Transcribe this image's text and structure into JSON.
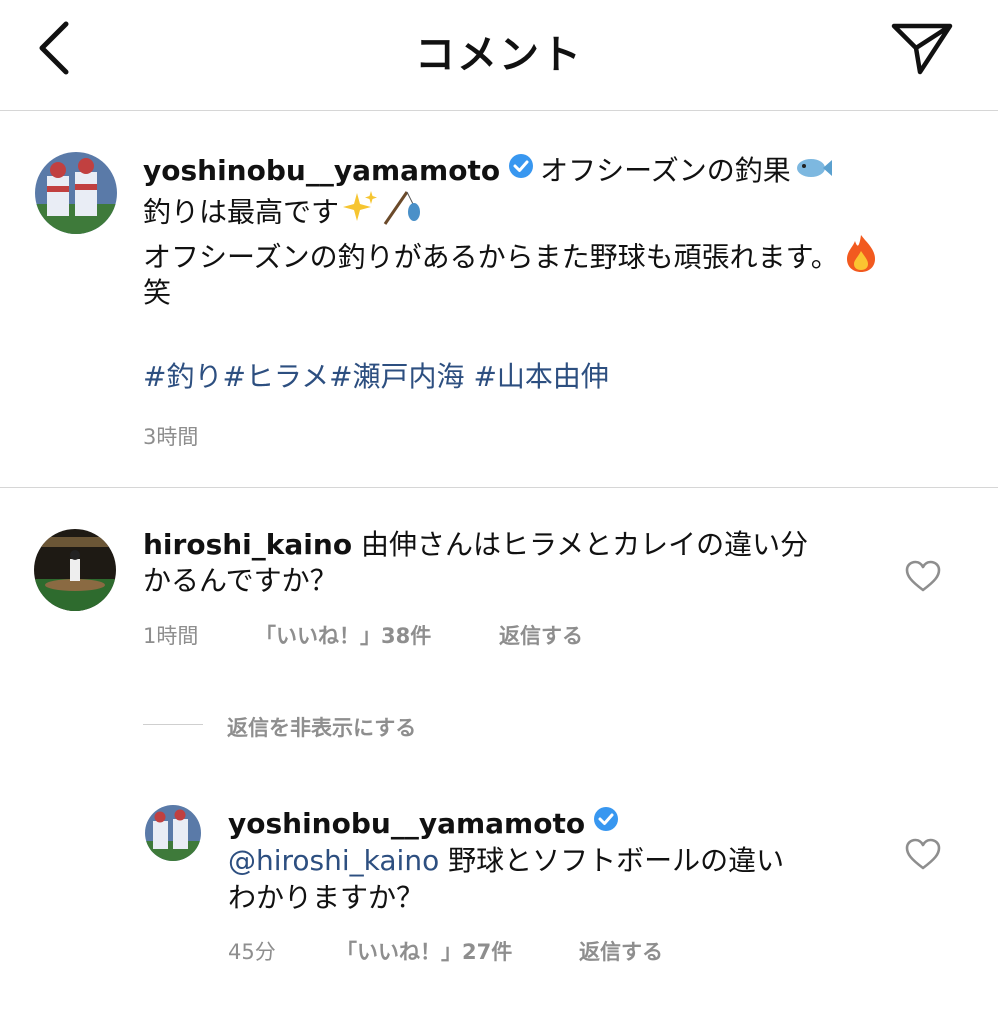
{
  "header": {
    "title": "コメント"
  },
  "post": {
    "username": "yoshinobu__yamamoto",
    "line1": "オフシーズンの釣果",
    "line2": "釣りは最高です",
    "line3": "オフシーズンの釣りがあるからまた野球も頑張れます。",
    "line4": "笑",
    "hashtags": [
      "#釣り",
      "#ヒラメ",
      "#瀬戸内海",
      "#山本由伸"
    ],
    "time": "3時間"
  },
  "comment": {
    "username": "hiroshi_kaino",
    "text_line1": "由伸さんはヒラメとカレイの違い分",
    "text_line2": "かるんですか？",
    "time": "1時間",
    "likes": "「いいね！」38件",
    "reply": "返信する"
  },
  "hide_replies": "返信を非表示にする",
  "reply": {
    "username": "yoshinobu__yamamoto",
    "mention": "@hiroshi_kaino",
    "text_line1": "野球とソフトボールの違い",
    "text_line2": "わかりますか？",
    "time": "45分",
    "likes": "「いいね！」27件",
    "reply": "返信する"
  },
  "colors": {
    "link": "#2d4f80",
    "verified": "#3897f0",
    "muted": "#8e8e8e"
  }
}
